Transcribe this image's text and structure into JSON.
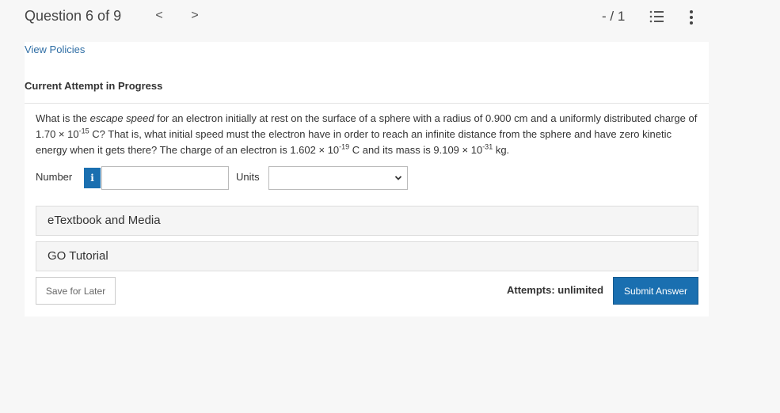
{
  "header": {
    "title": "Question 6 of 9",
    "prev": "<",
    "next": ">",
    "score": "- / 1"
  },
  "links": {
    "view_policies": "View Policies"
  },
  "status": {
    "attempt": "Current Attempt in Progress"
  },
  "question": {
    "t1": "What is the ",
    "em": "escape speed",
    "t2": " for an electron initially at rest on the surface of a sphere with a radius of 0.900 cm and a uniformly distributed charge of 1.70 × 10",
    "sup1": "-15",
    "t3": " C? That is, what initial speed must the electron have in order to reach an infinite distance from the sphere and have zero kinetic energy when it gets there? The charge of an electron is 1.602 × 10",
    "sup2": "-19",
    "t4": " C and its mass is 9.109 × 10",
    "sup3": "-31",
    "t5": " kg."
  },
  "answer": {
    "number_label": "Number",
    "info_label": "i",
    "number_value": "",
    "units_label": "Units",
    "units_value": ""
  },
  "panels": {
    "etextbook": "eTextbook and Media",
    "go_tutorial": "GO Tutorial"
  },
  "footer": {
    "save_label": "Save for Later",
    "attempts": "Attempts: unlimited",
    "submit_label": "Submit Answer"
  },
  "icons": {
    "list": "list-icon",
    "more": "more-vertical-icon",
    "chevron": "chevron-down-icon"
  },
  "colors": {
    "accent": "#1a6fb0",
    "link": "#2f6ea5"
  }
}
